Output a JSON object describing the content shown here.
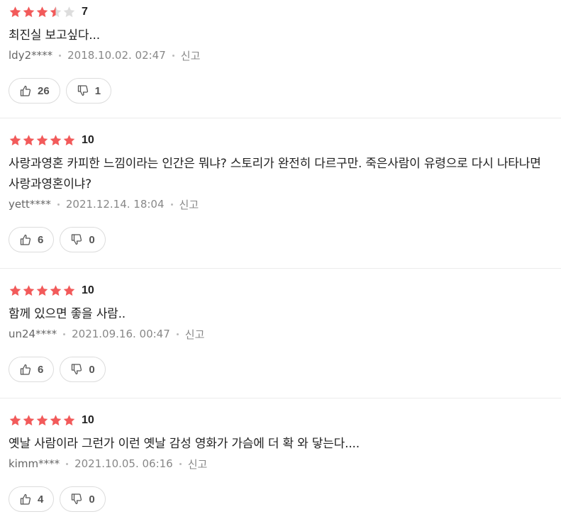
{
  "colors": {
    "star_filled": "#f25a5a",
    "star_empty": "#dddddd"
  },
  "reviews": [
    {
      "rating": 3.5,
      "score": "7",
      "comment": "최진실 보고싶다...",
      "user": "ldy2****",
      "date": "2018.10.02. 02:47",
      "report": "신고",
      "likes": "26",
      "dislikes": "1"
    },
    {
      "rating": 5,
      "score": "10",
      "comment": "사랑과영혼 카피한 느낌이라는 인간은 뭐냐? 스토리가 완전히 다르구만. 죽은사람이 유령으로 다시 나타나면 사랑과영혼이냐?",
      "user": "yett****",
      "date": "2021.12.14. 18:04",
      "report": "신고",
      "likes": "6",
      "dislikes": "0"
    },
    {
      "rating": 5,
      "score": "10",
      "comment": "함께 있으면 좋을 사람..",
      "user": "un24****",
      "date": "2021.09.16. 00:47",
      "report": "신고",
      "likes": "6",
      "dislikes": "0"
    },
    {
      "rating": 5,
      "score": "10",
      "comment": "옛날 사람이라 그런가 이런 옛날 감성 영화가 가슴에 더 확 와 닿는다....",
      "user": "kimm****",
      "date": "2021.10.05. 06:16",
      "report": "신고",
      "likes": "4",
      "dislikes": "0"
    }
  ]
}
